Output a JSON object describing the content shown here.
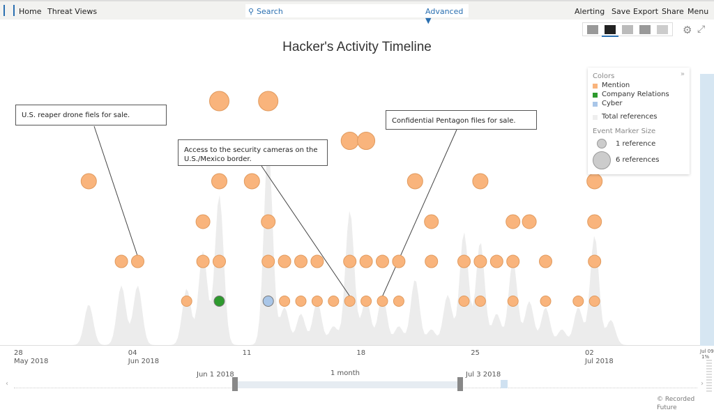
{
  "nav": {
    "home": "Home",
    "threat_views": "Threat Views",
    "search_placeholder": "Search",
    "advanced": "Advanced ▼",
    "alerting": "Alerting",
    "save": "Save",
    "export": "Export",
    "share": "Share",
    "menu": "Menu"
  },
  "title": "Hacker's Activity Timeline",
  "colors": {
    "mention": "#f9b47c",
    "company_relations": "#2e9a2e",
    "cyber": "#a9c6e8",
    "total": "#ececec"
  },
  "legend": {
    "colors_label": "Colors",
    "items": [
      "Mention",
      "Company Relations",
      "Cyber",
      "Total references"
    ],
    "size_label": "Event Marker Size",
    "size_small": "1 reference",
    "size_large": "6 references"
  },
  "callouts": [
    "U.S. reaper drone fiels for sale.",
    "Access to the security cameras on the U.S./Mexico border.",
    "Confidential Pentagon files for sale."
  ],
  "axis": {
    "ticks": [
      {
        "d": "28",
        "m": "May 2018"
      },
      {
        "d": "04",
        "m": "Jun 2018"
      },
      {
        "d": "11",
        "m": ""
      },
      {
        "d": "18",
        "m": ""
      },
      {
        "d": "25",
        "m": ""
      },
      {
        "d": "02",
        "m": "Jul 2018"
      }
    ]
  },
  "navigator": {
    "start": "Jun 1 2018",
    "end": "Jul 3 2018",
    "span": "1 month",
    "right_label": "Jul 09",
    "pct": "1%"
  },
  "footer": "© Recorded Future",
  "events": [
    {
      "day": 4,
      "level": 4,
      "type": "mention"
    },
    {
      "day": 6,
      "level": 2,
      "type": "mention"
    },
    {
      "day": 7,
      "level": 2,
      "type": "mention"
    },
    {
      "day": 10,
      "level": 1,
      "type": "mention"
    },
    {
      "day": 11,
      "level": 2,
      "type": "mention"
    },
    {
      "day": 11,
      "level": 3,
      "type": "mention"
    },
    {
      "day": 12,
      "level": 1,
      "type": "company_relations"
    },
    {
      "day": 12,
      "level": 2,
      "type": "mention"
    },
    {
      "day": 12,
      "level": 4,
      "type": "mention"
    },
    {
      "day": 12,
      "level": 6,
      "type": "mention"
    },
    {
      "day": 14,
      "level": 4,
      "type": "mention"
    },
    {
      "day": 15,
      "level": 1,
      "type": "cyber"
    },
    {
      "day": 15,
      "level": 2,
      "type": "mention"
    },
    {
      "day": 15,
      "level": 3,
      "type": "mention"
    },
    {
      "day": 15,
      "level": 6,
      "type": "mention"
    },
    {
      "day": 16,
      "level": 1,
      "type": "mention"
    },
    {
      "day": 16,
      "level": 2,
      "type": "mention"
    },
    {
      "day": 17,
      "level": 1,
      "type": "mention"
    },
    {
      "day": 17,
      "level": 2,
      "type": "mention"
    },
    {
      "day": 18,
      "level": 1,
      "type": "mention"
    },
    {
      "day": 18,
      "level": 2,
      "type": "mention"
    },
    {
      "day": 19,
      "level": 1,
      "type": "mention"
    },
    {
      "day": 20,
      "level": 1,
      "type": "mention"
    },
    {
      "day": 20,
      "level": 2,
      "type": "mention"
    },
    {
      "day": 20,
      "level": 5,
      "type": "mention"
    },
    {
      "day": 21,
      "level": 1,
      "type": "mention"
    },
    {
      "day": 21,
      "level": 2,
      "type": "mention"
    },
    {
      "day": 21,
      "level": 5,
      "type": "mention"
    },
    {
      "day": 22,
      "level": 1,
      "type": "mention"
    },
    {
      "day": 22,
      "level": 2,
      "type": "mention"
    },
    {
      "day": 23,
      "level": 1,
      "type": "mention"
    },
    {
      "day": 23,
      "level": 2,
      "type": "mention"
    },
    {
      "day": 24,
      "level": 4,
      "type": "mention"
    },
    {
      "day": 25,
      "level": 2,
      "type": "mention"
    },
    {
      "day": 25,
      "level": 3,
      "type": "mention"
    },
    {
      "day": 27,
      "level": 1,
      "type": "mention"
    },
    {
      "day": 27,
      "level": 2,
      "type": "mention"
    },
    {
      "day": 28,
      "level": 1,
      "type": "mention"
    },
    {
      "day": 28,
      "level": 2,
      "type": "mention"
    },
    {
      "day": 28,
      "level": 4,
      "type": "mention"
    },
    {
      "day": 29,
      "level": 2,
      "type": "mention"
    },
    {
      "day": 30,
      "level": 1,
      "type": "mention"
    },
    {
      "day": 30,
      "level": 2,
      "type": "mention"
    },
    {
      "day": 30,
      "level": 3,
      "type": "mention"
    },
    {
      "day": 31,
      "level": 3,
      "type": "mention"
    },
    {
      "day": 32,
      "level": 1,
      "type": "mention"
    },
    {
      "day": 32,
      "level": 2,
      "type": "mention"
    },
    {
      "day": 34,
      "level": 1,
      "type": "mention"
    },
    {
      "day": 35,
      "level": 1,
      "type": "mention"
    },
    {
      "day": 35,
      "level": 2,
      "type": "mention"
    },
    {
      "day": 35,
      "level": 3,
      "type": "mention"
    },
    {
      "day": 35,
      "level": 4,
      "type": "mention"
    }
  ],
  "density": [
    0,
    0,
    0,
    0,
    1.3,
    0,
    1.9,
    1.9,
    0,
    0,
    1.8,
    3,
    4.8,
    0,
    0,
    6.4,
    1.2,
    1,
    1.4,
    0.6,
    4.3,
    1.5,
    1.6,
    0.6,
    2.1,
    0.5,
    1.6,
    3.6,
    3.3,
    1,
    2.7,
    1.4,
    1.2,
    0.5,
    1.2,
    3.5,
    0.8
  ]
}
